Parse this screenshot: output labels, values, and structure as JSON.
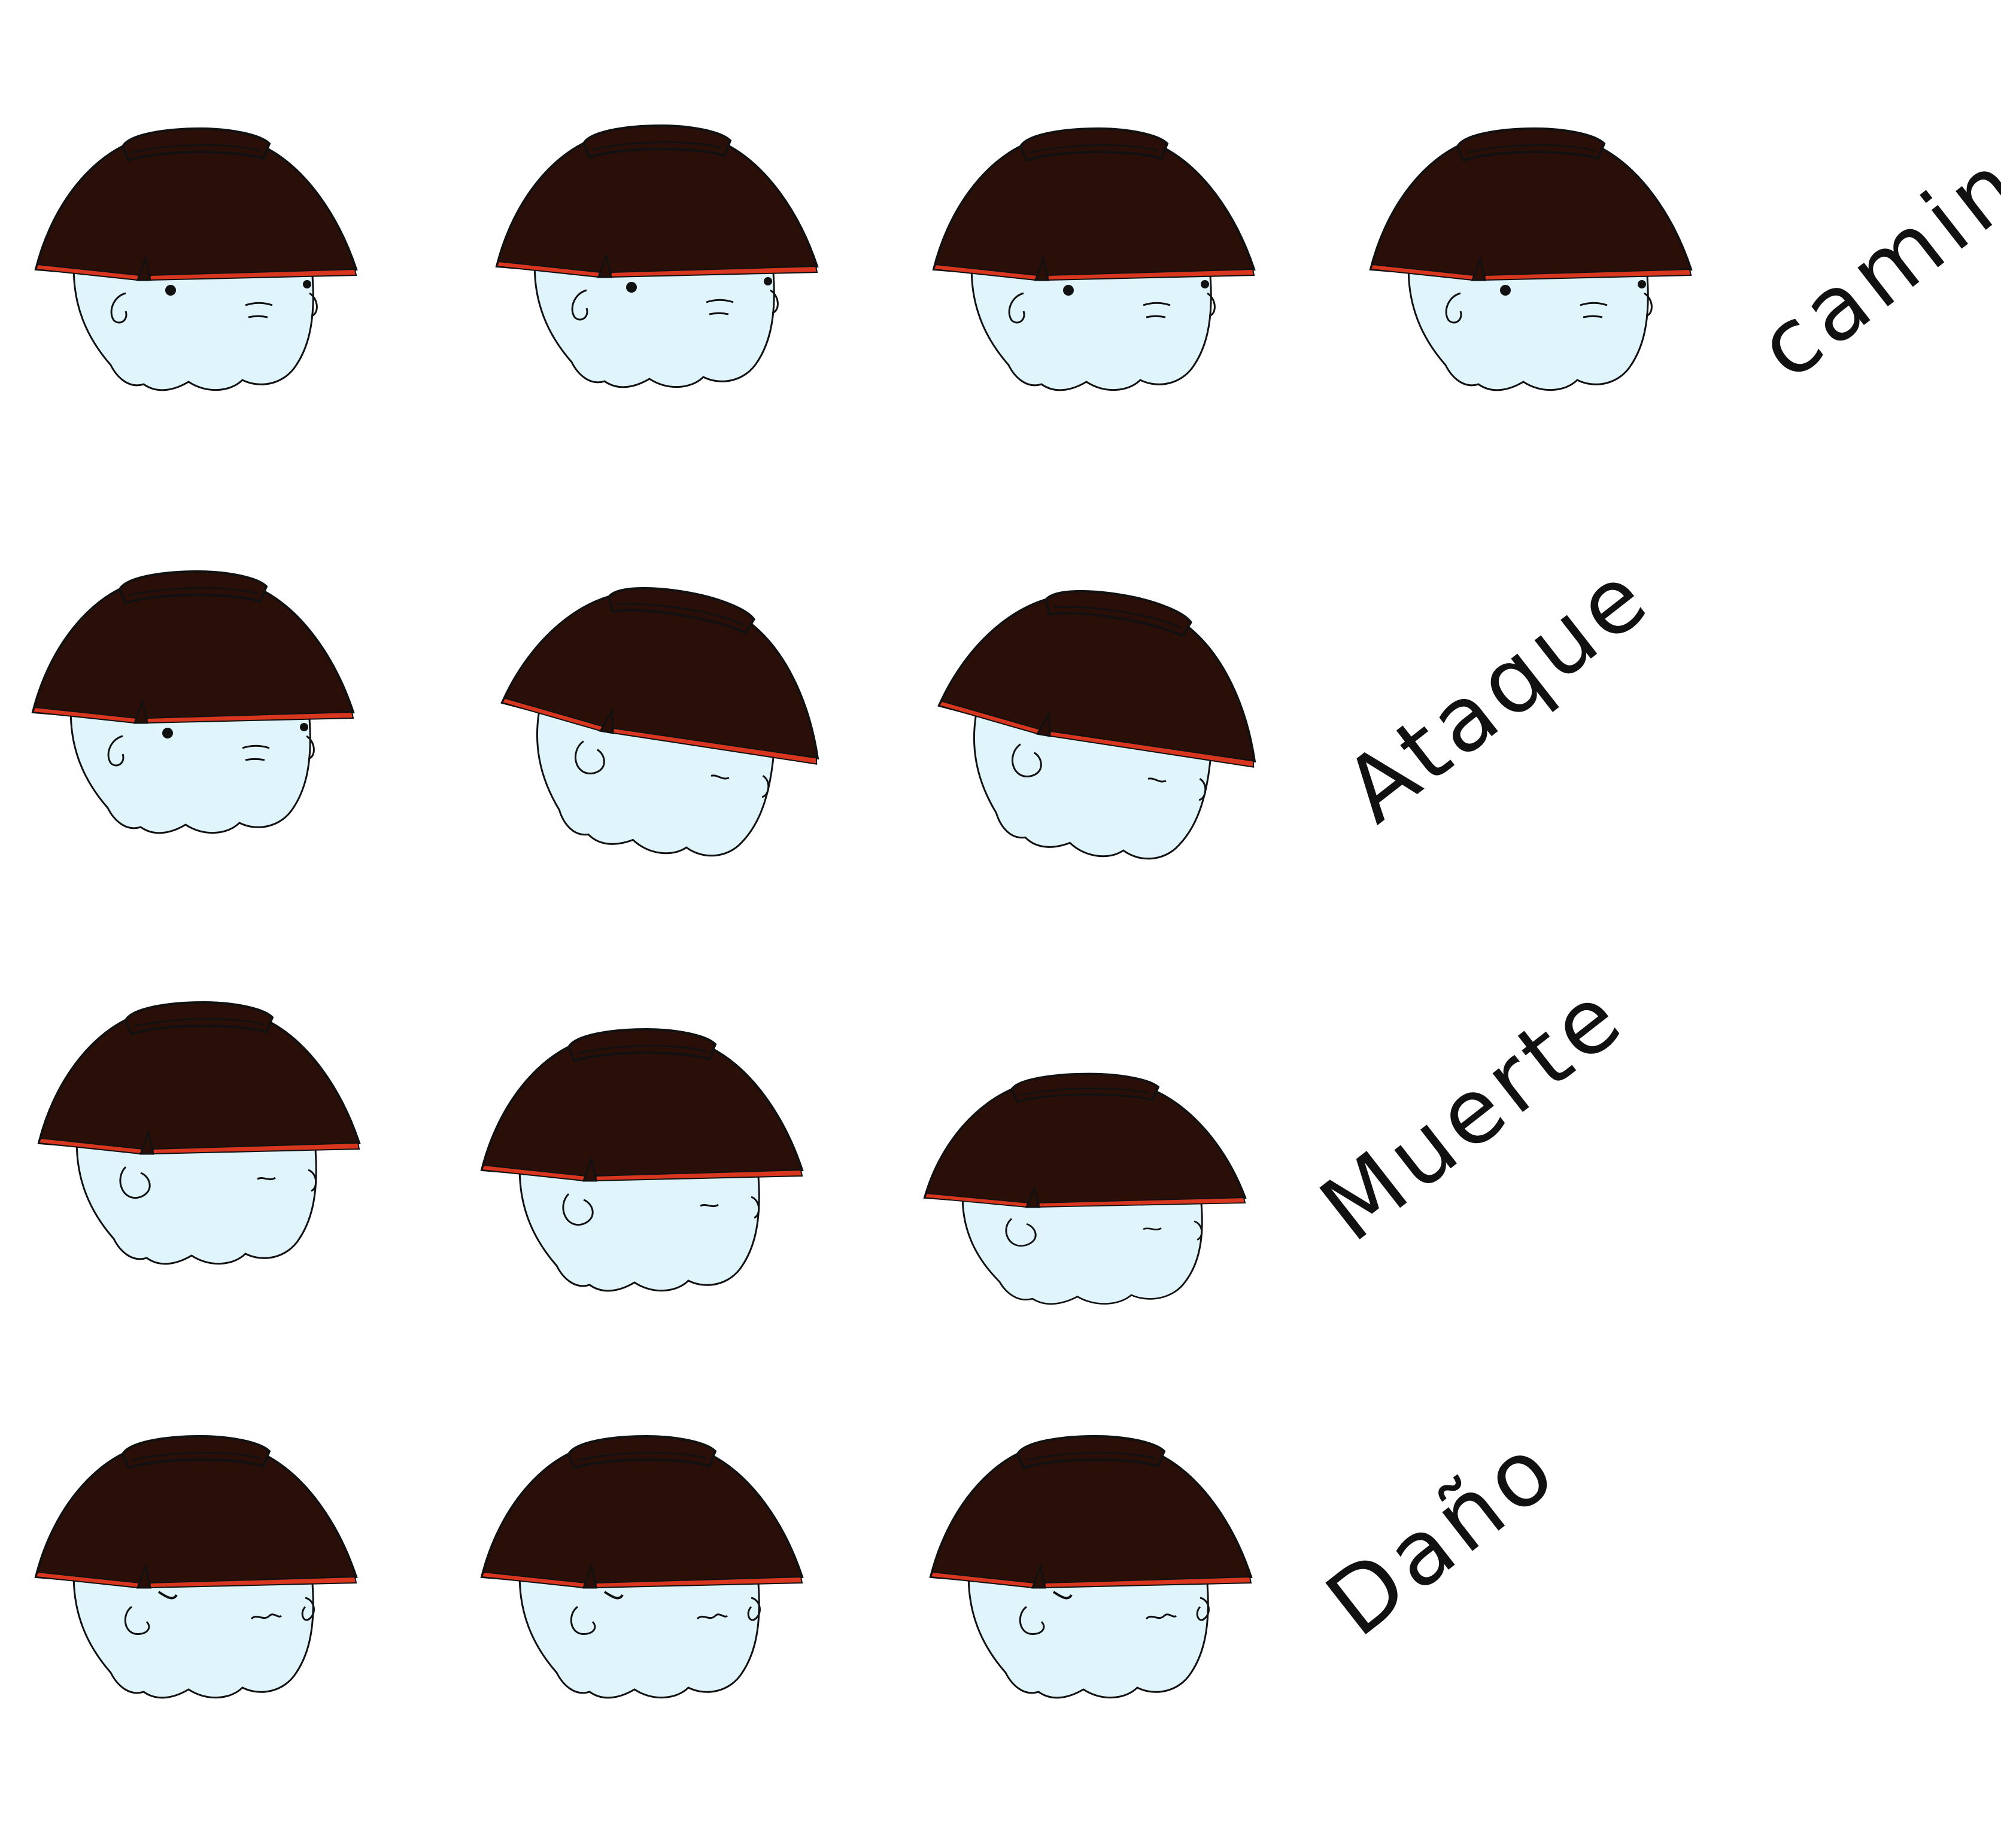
{
  "title": "",
  "colors": {
    "background": "#ffffff",
    "hat": "#2a0f09",
    "hat_band": "#d9361f",
    "skin": "#dff4fb",
    "outline": "#111111"
  },
  "rows": [
    {
      "label": "caminado",
      "frames": [
        {
          "pose": "walk-1",
          "expression": "neutral"
        },
        {
          "pose": "walk-2",
          "expression": "neutral"
        },
        {
          "pose": "walk-3",
          "expression": "neutral"
        },
        {
          "pose": "walk-4",
          "expression": "neutral"
        }
      ]
    },
    {
      "label": "Ataque",
      "frames": [
        {
          "pose": "attack-1",
          "expression": "neutral"
        },
        {
          "pose": "attack-2",
          "expression": "tilted"
        },
        {
          "pose": "attack-3",
          "expression": "tilted"
        }
      ]
    },
    {
      "label": "Muerte",
      "frames": [
        {
          "pose": "death-1",
          "expression": "hidden"
        },
        {
          "pose": "death-2",
          "expression": "hidden"
        },
        {
          "pose": "death-3",
          "expression": "squashed"
        }
      ]
    },
    {
      "label": "Daño",
      "frames": [
        {
          "pose": "hurt-1",
          "expression": "pained"
        },
        {
          "pose": "hurt-2",
          "expression": "pained"
        },
        {
          "pose": "hurt-3",
          "expression": "pained"
        }
      ]
    }
  ]
}
